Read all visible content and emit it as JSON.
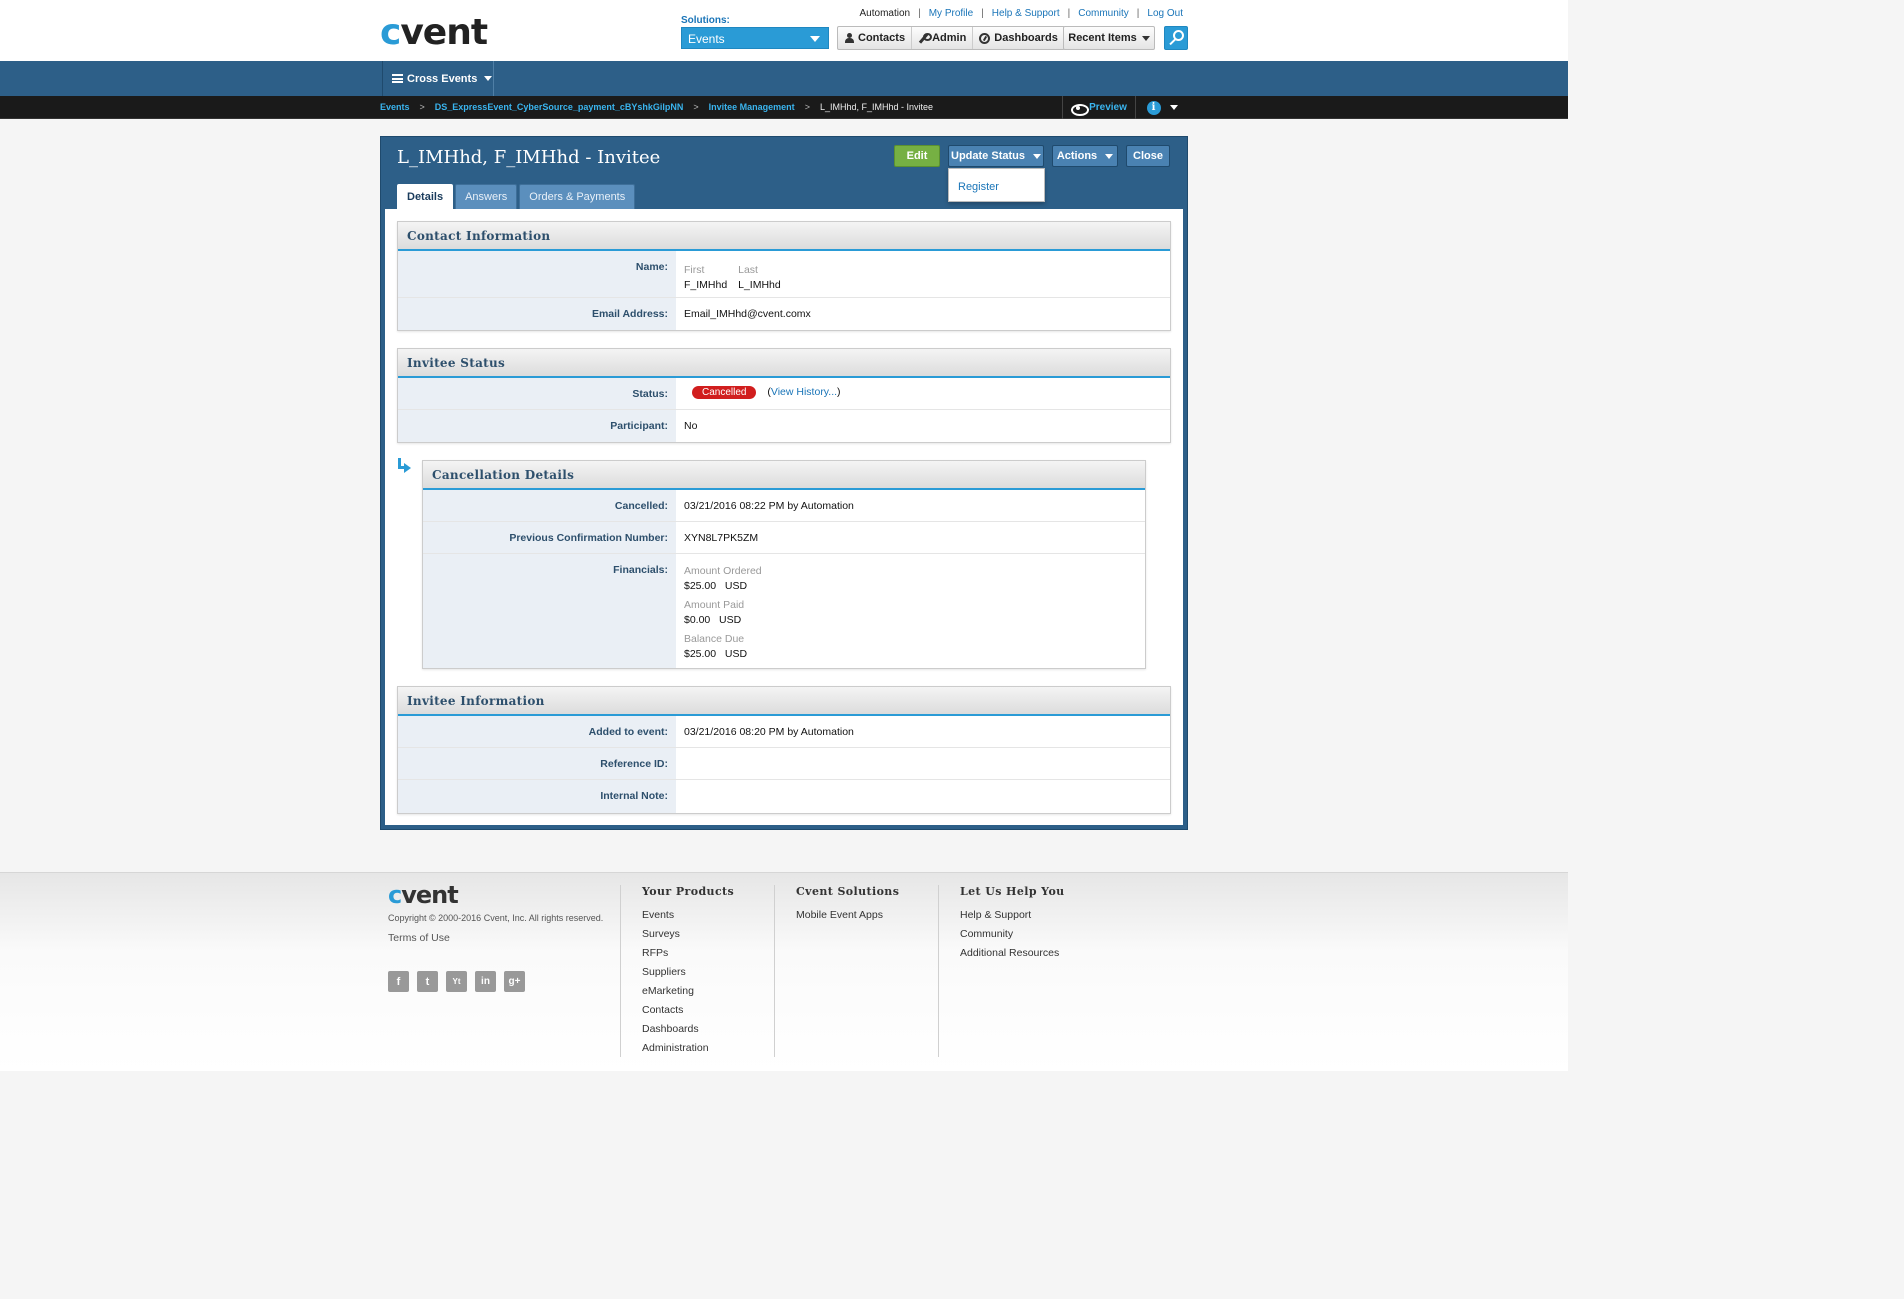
{
  "header": {
    "logo": "cvent",
    "user": "Automation",
    "links": [
      "My Profile",
      "Help & Support",
      "Community",
      "Log Out"
    ],
    "solutions_label": "Solutions:",
    "solutions_value": "Events",
    "buttons": [
      "Contacts",
      "Admin",
      "Dashboards"
    ],
    "recent_items": "Recent Items"
  },
  "nav": {
    "cross_events": "Cross Events"
  },
  "breadcrumb": {
    "events": "Events",
    "event": "DS_ExpressEvent_CyberSource_payment_cBYshkGilpNN",
    "invitee_mgmt": "Invitee Management",
    "current": "L_IMHhd, F_IMHhd - Invitee",
    "preview": "Preview"
  },
  "panel": {
    "title": "L_IMHhd, F_IMHhd - Invitee",
    "edit": "Edit",
    "update_status": "Update Status",
    "actions": "Actions",
    "close": "Close",
    "status_menu_item": "Register",
    "tabs": [
      "Details",
      "Answers",
      "Orders & Payments"
    ]
  },
  "contact": {
    "title": "Contact Information",
    "name_label": "Name:",
    "first_label": "First",
    "first_value": "F_IMHhd",
    "last_label": "Last",
    "last_value": "L_IMHhd",
    "email_label": "Email Address:",
    "email_value": "Email_IMHhd@cvent.comx"
  },
  "status": {
    "title": "Invitee Status",
    "status_label": "Status:",
    "status_value": "Cancelled",
    "history_link": "View History...",
    "participant_label": "Participant:",
    "participant_value": "No"
  },
  "cancellation": {
    "title": "Cancellation Details",
    "cancelled_label": "Cancelled:",
    "cancelled_value": "03/21/2016 08:22 PM by Automation",
    "prev_conf_label": "Previous Confirmation Number:",
    "prev_conf_value": "XYN8L7PK5ZM",
    "financials_label": "Financials:",
    "amount_ordered_label": "Amount Ordered",
    "amount_ordered_value": "$25.00",
    "amount_paid_label": "Amount Paid",
    "amount_paid_value": "$0.00",
    "balance_due_label": "Balance Due",
    "balance_due_value": "$25.00",
    "currency": "USD"
  },
  "invitee": {
    "title": "Invitee Information",
    "added_label": "Added to event:",
    "added_value": "03/21/2016 08:20 PM by Automation",
    "reference_label": "Reference ID:",
    "note_label": "Internal Note:"
  },
  "footer": {
    "logo": "cvent",
    "copyright": "Copyright © 2000-2016 Cvent, Inc. All rights reserved.",
    "terms": "Terms of Use",
    "products_title": "Your Products",
    "products": [
      "Events",
      "Surveys",
      "RFPs",
      "Suppliers",
      "eMarketing",
      "Contacts",
      "Dashboards",
      "Administration"
    ],
    "solutions_title": "Cvent Solutions",
    "solutions": [
      "Mobile Event Apps"
    ],
    "help_title": "Let Us Help You",
    "help": [
      "Help & Support",
      "Community",
      "Additional Resources"
    ]
  },
  "colors": {
    "brand_blue": "#2a9bd6",
    "panel_blue": "#2d5f88",
    "edit_green": "#76b043",
    "cancelled_red": "#d11e1e"
  }
}
